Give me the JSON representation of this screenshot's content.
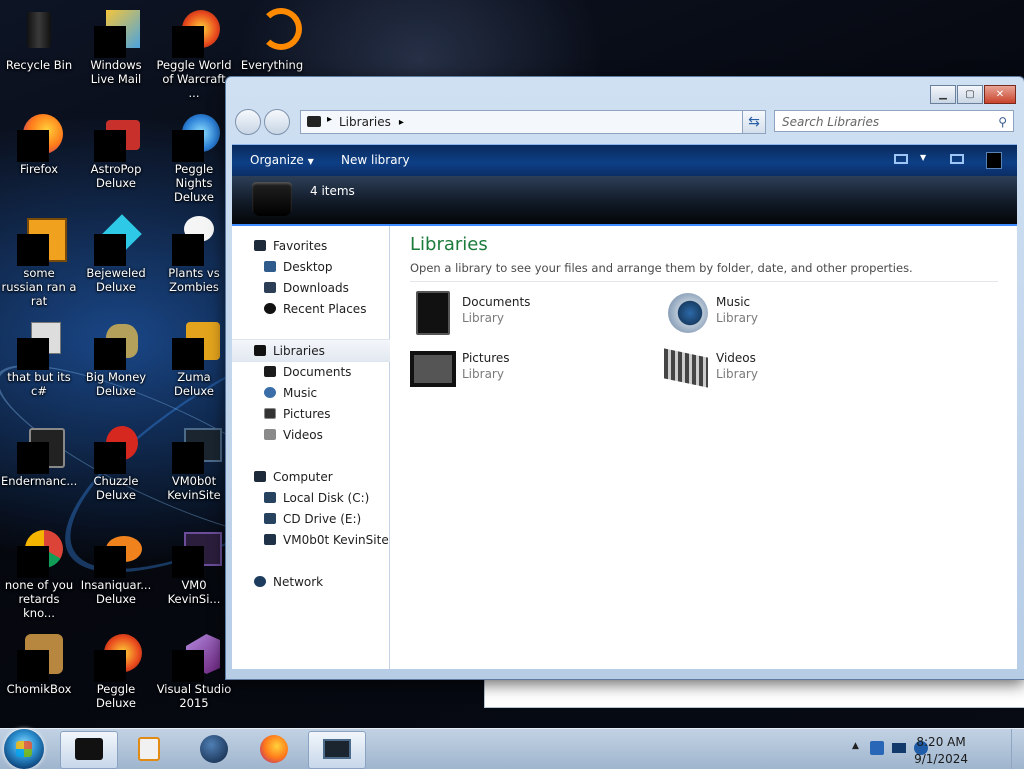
{
  "desktop": {
    "icons": [
      {
        "label": "Recycle Bin"
      },
      {
        "label": "Windows Live Mail"
      },
      {
        "label": "Peggle World of Warcraft ..."
      },
      {
        "label": "Everything"
      },
      {
        "label": "Firefox"
      },
      {
        "label": "AstroPop Deluxe"
      },
      {
        "label": "Peggle Nights Deluxe"
      },
      {
        "label": "some russian ran a rat"
      },
      {
        "label": "Bejeweled Deluxe"
      },
      {
        "label": "Plants vs Zombies"
      },
      {
        "label": "that but its c#"
      },
      {
        "label": "Big Money Deluxe"
      },
      {
        "label": "Zuma Deluxe"
      },
      {
        "label": "Endermanc..."
      },
      {
        "label": "Chuzzle Deluxe"
      },
      {
        "label": "VM0b0t KevinSite"
      },
      {
        "label": "none of you retards kno..."
      },
      {
        "label": "Insaniquar... Deluxe"
      },
      {
        "label": "VM0 KevinSi..."
      },
      {
        "label": "ChomikBox"
      },
      {
        "label": "Peggle Deluxe"
      },
      {
        "label": "Visual Studio 2015"
      }
    ]
  },
  "window": {
    "breadcrumb": "Libraries",
    "search_placeholder": "Search Libraries",
    "toolbar": {
      "organize": "Organize",
      "new_library": "New library"
    },
    "item_count": "4 items",
    "nav": {
      "favorites": "Favorites",
      "favorites_items": [
        "Desktop",
        "Downloads",
        "Recent Places"
      ],
      "libraries": "Libraries",
      "libraries_items": [
        "Documents",
        "Music",
        "Pictures",
        "Videos"
      ],
      "computer": "Computer",
      "computer_items": [
        "Local Disk (C:)",
        "CD Drive (E:)",
        "VM0b0t KevinSite"
      ],
      "network": "Network"
    },
    "content": {
      "title": "Libraries",
      "subtitle": "Open a library to see your files and arrange them by folder, date, and other properties.",
      "items": [
        {
          "name": "Documents",
          "type": "Library"
        },
        {
          "name": "Music",
          "type": "Library"
        },
        {
          "name": "Pictures",
          "type": "Library"
        },
        {
          "name": "Videos",
          "type": "Library"
        }
      ]
    }
  },
  "taskbar": {
    "time": "8:20 AM",
    "date": "9/1/2024"
  }
}
